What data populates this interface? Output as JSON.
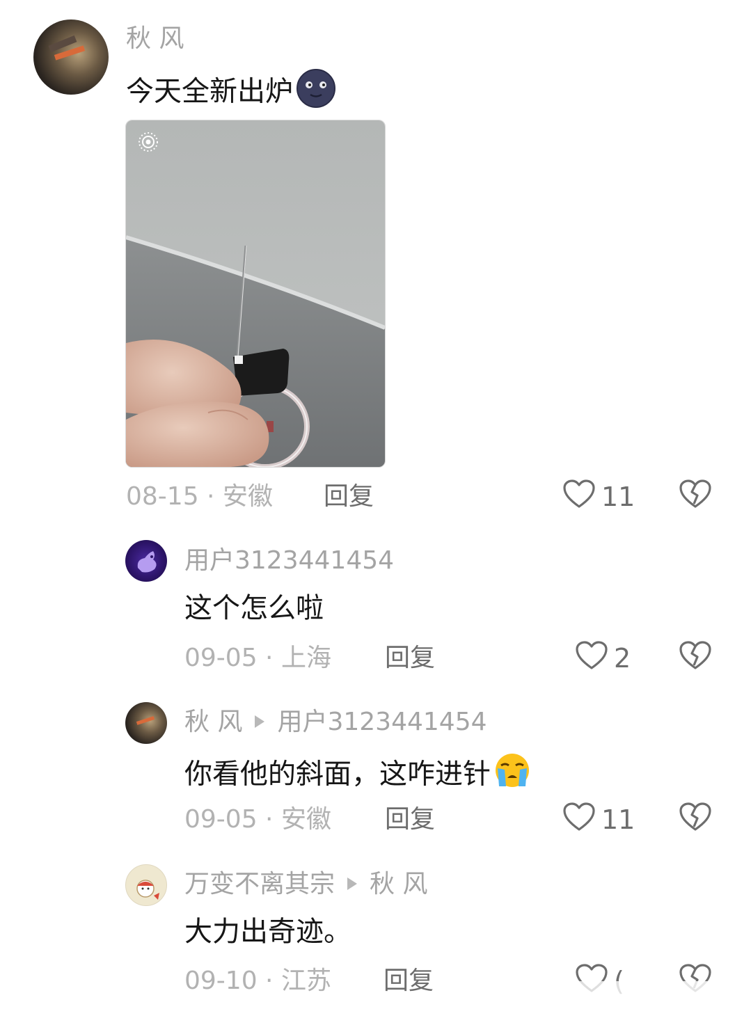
{
  "post": {
    "author": "秋 风",
    "text": "今天全新出炉",
    "emoji": "new-moon-face-emoji",
    "date_location": "08-15 · 安徽",
    "reply_label": "回复",
    "likes": "11"
  },
  "replies": [
    {
      "author": "用户3123441454",
      "text": "这个怎么啦",
      "date_location": "09-05 · 上海",
      "reply_label": "回复",
      "likes": "2"
    },
    {
      "author": "秋 风",
      "reply_to": "用户3123441454",
      "text": "你看他的斜面，这咋进针",
      "emoji": "loudly-crying-face-emoji",
      "date_location": "09-05 · 安徽",
      "reply_label": "回复",
      "likes": "11"
    },
    {
      "author": "万变不离其宗",
      "reply_to": "秋 风",
      "text": "大力出奇迹。",
      "date_location": "09-10 · 江苏",
      "reply_label": "回复",
      "likes": "("
    }
  ],
  "colors": {
    "name": "#a4a4a4",
    "text": "#161616",
    "meta": "#b2b2b2",
    "action": "#6d6d6d"
  }
}
